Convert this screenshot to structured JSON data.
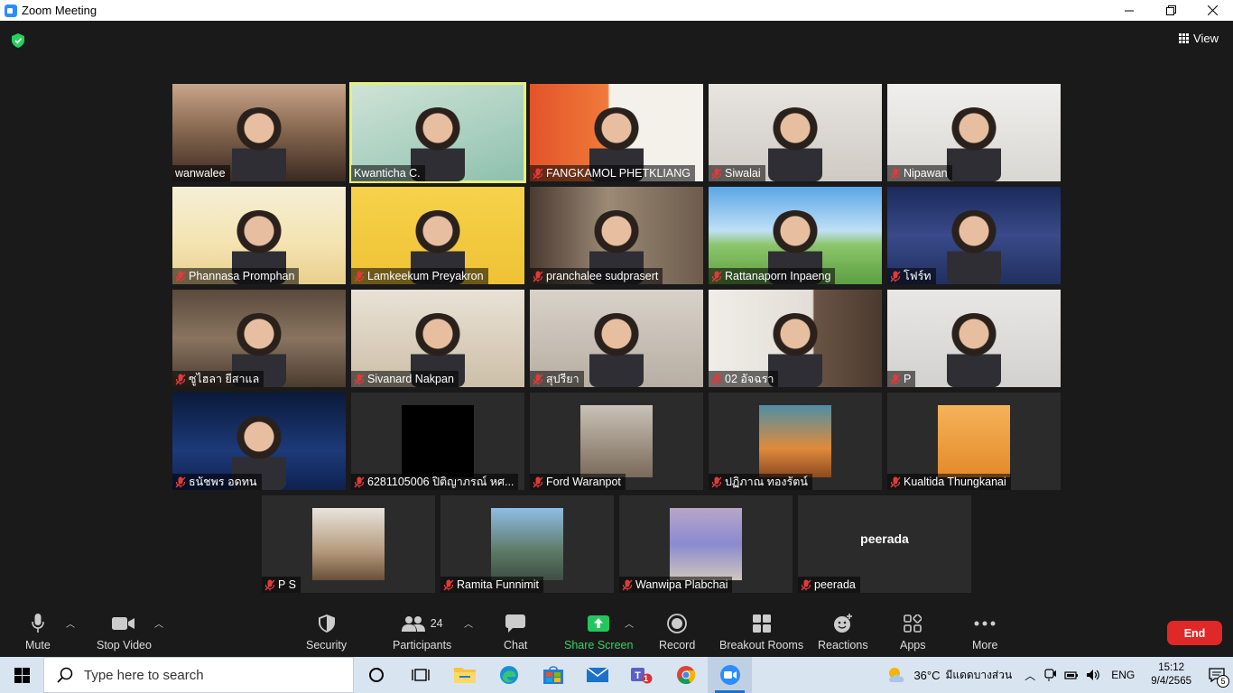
{
  "window": {
    "title": "Zoom Meeting",
    "minimize": "—",
    "restore": "❐",
    "close": "✕"
  },
  "meeting": {
    "view_label": "View",
    "accent_active": "#e5f07a",
    "end_color": "#e02828"
  },
  "participants": [
    {
      "name": "wanwalee",
      "muted": false,
      "active": false
    },
    {
      "name": "Kwanticha C.",
      "muted": false,
      "active": true
    },
    {
      "name": "FANGKAMOL PHETKLIANG",
      "muted": true,
      "active": false
    },
    {
      "name": "Siwalai",
      "muted": true,
      "active": false
    },
    {
      "name": "Nipawan",
      "muted": true,
      "active": false
    },
    {
      "name": "Phannasa Promphan",
      "muted": true,
      "active": false
    },
    {
      "name": "Lamkeekum Preyakron",
      "muted": true,
      "active": false
    },
    {
      "name": "pranchalee sudprasert",
      "muted": true,
      "active": false
    },
    {
      "name": "Rattanaporn Inpaeng",
      "muted": true,
      "active": false
    },
    {
      "name": "โฟร์ท",
      "muted": true,
      "active": false
    },
    {
      "name": "ซูไฮลา ยีสาแล",
      "muted": true,
      "active": false
    },
    {
      "name": "Sivanard Nakpan",
      "muted": true,
      "active": false
    },
    {
      "name": "สุปรียา",
      "muted": true,
      "active": false
    },
    {
      "name": "02 อัจฉรา",
      "muted": true,
      "active": false
    },
    {
      "name": "P",
      "muted": true,
      "active": false
    },
    {
      "name": "ธนัชพร อดทน",
      "muted": true,
      "active": false
    },
    {
      "name": "6281105006 ปิติญาภรณ์ หศ...",
      "muted": true,
      "active": false
    },
    {
      "name": "Ford Waranpot",
      "muted": true,
      "active": false
    },
    {
      "name": "ปฏิภาณ ทองรัตน์",
      "muted": true,
      "active": false
    },
    {
      "name": "Kualtida Thungkanai",
      "muted": true,
      "active": false
    },
    {
      "name": "P S",
      "muted": true,
      "active": false
    },
    {
      "name": "Ramita Funnimit",
      "muted": true,
      "active": false
    },
    {
      "name": "Wanwipa Plabchai",
      "muted": true,
      "active": false
    },
    {
      "name": "peerada",
      "muted": true,
      "active": false,
      "big_label": "peerada"
    }
  ],
  "toolbar": {
    "mute": "Mute",
    "stop_video": "Stop Video",
    "security": "Security",
    "participants": "Participants",
    "participant_count": "24",
    "chat": "Chat",
    "share_screen": "Share Screen",
    "record": "Record",
    "breakout_rooms": "Breakout Rooms",
    "reactions": "Reactions",
    "apps": "Apps",
    "more": "More",
    "end": "End"
  },
  "taskbar": {
    "search_placeholder": "Type here to search",
    "weather_temp": "36°C",
    "weather_text": "มีแดดบางส่วน",
    "language": "ENG",
    "time": "15:12",
    "date": "9/4/2565",
    "notification_count": "5",
    "teams_badge": "1"
  }
}
